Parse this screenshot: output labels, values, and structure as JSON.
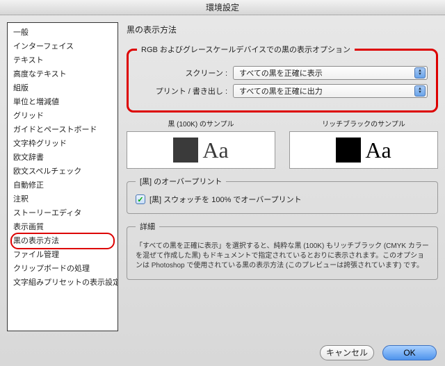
{
  "title": "環境設定",
  "sidebar": {
    "items": [
      {
        "label": "一般"
      },
      {
        "label": "インターフェイス"
      },
      {
        "label": "テキスト"
      },
      {
        "label": "高度なテキスト"
      },
      {
        "label": "組版"
      },
      {
        "label": "単位と増減値"
      },
      {
        "label": "グリッド"
      },
      {
        "label": "ガイドとペーストボード"
      },
      {
        "label": "文字枠グリッド"
      },
      {
        "label": "欧文辞書"
      },
      {
        "label": "欧文スペルチェック"
      },
      {
        "label": "自動修正"
      },
      {
        "label": "注釈"
      },
      {
        "label": "ストーリーエディタ"
      },
      {
        "label": "表示画質"
      },
      {
        "label": "黒の表示方法",
        "selected": true
      },
      {
        "label": "ファイル管理"
      },
      {
        "label": "クリップボードの処理"
      },
      {
        "label": "文字組みプリセットの表示設定"
      }
    ]
  },
  "main": {
    "header": "黒の表示方法",
    "rgb_group": {
      "legend": "RGB およびグレースケールデバイスでの黒の表示オプション",
      "screen_label": "スクリーン :",
      "screen_value": "すべての黒を正確に表示",
      "print_label": "プリント / 書き出し :",
      "print_value": "すべての黒を正確に出力",
      "sample_100k_label": "黒 (100K) のサンプル",
      "sample_rich_label": "リッチブラックのサンプル",
      "sample_text": "Aa"
    },
    "overprint_group": {
      "legend": "[黒] のオーバープリント",
      "checkbox_label": "[黒] スウォッチを 100% でオーバープリント",
      "checked": true
    },
    "detail_group": {
      "legend": "詳細",
      "text": "「すべての黒を正確に表示」を選択すると、純粋な黒 (100K) もリッチブラック (CMYK カラーを混ぜて作成した黒) もドキュメントで指定されているとおりに表示されます。このオプションは Photoshop で使用されている黒の表示方法 (このプレビューは誇張されています) です。"
    }
  },
  "footer": {
    "cancel": "キャンセル",
    "ok": "OK"
  }
}
